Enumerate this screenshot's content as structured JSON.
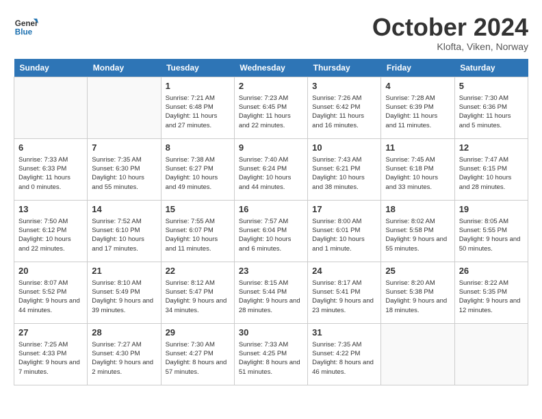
{
  "header": {
    "logo_line1": "General",
    "logo_line2": "Blue",
    "month": "October 2024",
    "location": "Klofta, Viken, Norway"
  },
  "days_of_week": [
    "Sunday",
    "Monday",
    "Tuesday",
    "Wednesday",
    "Thursday",
    "Friday",
    "Saturday"
  ],
  "weeks": [
    [
      {
        "day": "",
        "info": ""
      },
      {
        "day": "",
        "info": ""
      },
      {
        "day": "1",
        "info": "Sunrise: 7:21 AM\nSunset: 6:48 PM\nDaylight: 11 hours and 27 minutes."
      },
      {
        "day": "2",
        "info": "Sunrise: 7:23 AM\nSunset: 6:45 PM\nDaylight: 11 hours and 22 minutes."
      },
      {
        "day": "3",
        "info": "Sunrise: 7:26 AM\nSunset: 6:42 PM\nDaylight: 11 hours and 16 minutes."
      },
      {
        "day": "4",
        "info": "Sunrise: 7:28 AM\nSunset: 6:39 PM\nDaylight: 11 hours and 11 minutes."
      },
      {
        "day": "5",
        "info": "Sunrise: 7:30 AM\nSunset: 6:36 PM\nDaylight: 11 hours and 5 minutes."
      }
    ],
    [
      {
        "day": "6",
        "info": "Sunrise: 7:33 AM\nSunset: 6:33 PM\nDaylight: 11 hours and 0 minutes."
      },
      {
        "day": "7",
        "info": "Sunrise: 7:35 AM\nSunset: 6:30 PM\nDaylight: 10 hours and 55 minutes."
      },
      {
        "day": "8",
        "info": "Sunrise: 7:38 AM\nSunset: 6:27 PM\nDaylight: 10 hours and 49 minutes."
      },
      {
        "day": "9",
        "info": "Sunrise: 7:40 AM\nSunset: 6:24 PM\nDaylight: 10 hours and 44 minutes."
      },
      {
        "day": "10",
        "info": "Sunrise: 7:43 AM\nSunset: 6:21 PM\nDaylight: 10 hours and 38 minutes."
      },
      {
        "day": "11",
        "info": "Sunrise: 7:45 AM\nSunset: 6:18 PM\nDaylight: 10 hours and 33 minutes."
      },
      {
        "day": "12",
        "info": "Sunrise: 7:47 AM\nSunset: 6:15 PM\nDaylight: 10 hours and 28 minutes."
      }
    ],
    [
      {
        "day": "13",
        "info": "Sunrise: 7:50 AM\nSunset: 6:12 PM\nDaylight: 10 hours and 22 minutes."
      },
      {
        "day": "14",
        "info": "Sunrise: 7:52 AM\nSunset: 6:10 PM\nDaylight: 10 hours and 17 minutes."
      },
      {
        "day": "15",
        "info": "Sunrise: 7:55 AM\nSunset: 6:07 PM\nDaylight: 10 hours and 11 minutes."
      },
      {
        "day": "16",
        "info": "Sunrise: 7:57 AM\nSunset: 6:04 PM\nDaylight: 10 hours and 6 minutes."
      },
      {
        "day": "17",
        "info": "Sunrise: 8:00 AM\nSunset: 6:01 PM\nDaylight: 10 hours and 1 minute."
      },
      {
        "day": "18",
        "info": "Sunrise: 8:02 AM\nSunset: 5:58 PM\nDaylight: 9 hours and 55 minutes."
      },
      {
        "day": "19",
        "info": "Sunrise: 8:05 AM\nSunset: 5:55 PM\nDaylight: 9 hours and 50 minutes."
      }
    ],
    [
      {
        "day": "20",
        "info": "Sunrise: 8:07 AM\nSunset: 5:52 PM\nDaylight: 9 hours and 44 minutes."
      },
      {
        "day": "21",
        "info": "Sunrise: 8:10 AM\nSunset: 5:49 PM\nDaylight: 9 hours and 39 minutes."
      },
      {
        "day": "22",
        "info": "Sunrise: 8:12 AM\nSunset: 5:47 PM\nDaylight: 9 hours and 34 minutes."
      },
      {
        "day": "23",
        "info": "Sunrise: 8:15 AM\nSunset: 5:44 PM\nDaylight: 9 hours and 28 minutes."
      },
      {
        "day": "24",
        "info": "Sunrise: 8:17 AM\nSunset: 5:41 PM\nDaylight: 9 hours and 23 minutes."
      },
      {
        "day": "25",
        "info": "Sunrise: 8:20 AM\nSunset: 5:38 PM\nDaylight: 9 hours and 18 minutes."
      },
      {
        "day": "26",
        "info": "Sunrise: 8:22 AM\nSunset: 5:35 PM\nDaylight: 9 hours and 12 minutes."
      }
    ],
    [
      {
        "day": "27",
        "info": "Sunrise: 7:25 AM\nSunset: 4:33 PM\nDaylight: 9 hours and 7 minutes."
      },
      {
        "day": "28",
        "info": "Sunrise: 7:27 AM\nSunset: 4:30 PM\nDaylight: 9 hours and 2 minutes."
      },
      {
        "day": "29",
        "info": "Sunrise: 7:30 AM\nSunset: 4:27 PM\nDaylight: 8 hours and 57 minutes."
      },
      {
        "day": "30",
        "info": "Sunrise: 7:33 AM\nSunset: 4:25 PM\nDaylight: 8 hours and 51 minutes."
      },
      {
        "day": "31",
        "info": "Sunrise: 7:35 AM\nSunset: 4:22 PM\nDaylight: 8 hours and 46 minutes."
      },
      {
        "day": "",
        "info": ""
      },
      {
        "day": "",
        "info": ""
      }
    ]
  ]
}
